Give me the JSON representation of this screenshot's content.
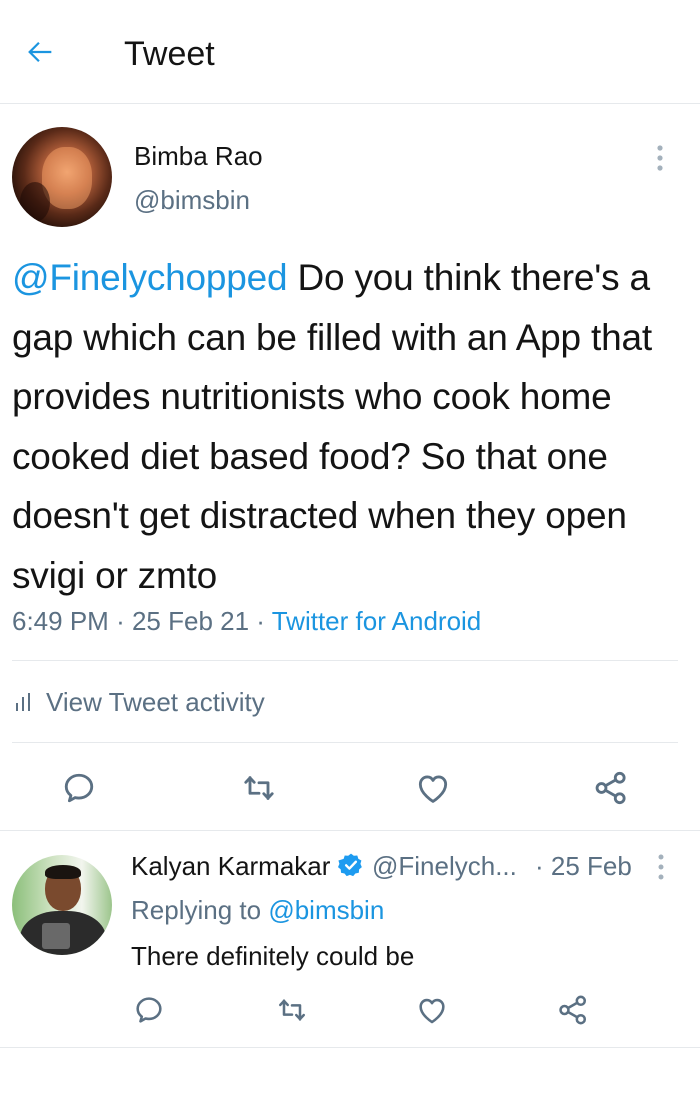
{
  "header": {
    "title": "Tweet",
    "back_icon": "arrow-left-icon",
    "accent": "#1b95e0"
  },
  "main_tweet": {
    "author": {
      "name": "Bimba Rao",
      "handle": "@bimsbin"
    },
    "mention": "@Finelychopped",
    "text": " Do you think there's a gap which can be filled with an App that provides nutritionists who cook home cooked diet based food? So that one doesn't get distracted when they open svigi or zmto",
    "time": "6:49 PM",
    "date": "25 Feb 21",
    "separator": "·",
    "source": "Twitter for Android",
    "activity_label": "View Tweet activity",
    "actions": [
      "reply-icon",
      "retweet-icon",
      "like-icon",
      "share-icon"
    ]
  },
  "reply_tweet": {
    "author": {
      "name": "Kalyan Karmakar",
      "handle": "@Finelych...",
      "verified": true
    },
    "date": "· 25 Feb",
    "replying_prefix": "Replying to ",
    "replying_to": "@bimsbin",
    "text": "There definitely could be",
    "actions": [
      "reply-icon",
      "retweet-icon",
      "like-icon",
      "share-icon"
    ]
  },
  "colors": {
    "accent": "#1b95e0",
    "secondary_text": "#5b7083",
    "primary_text": "#141414",
    "divider": "#e6e9ec"
  }
}
